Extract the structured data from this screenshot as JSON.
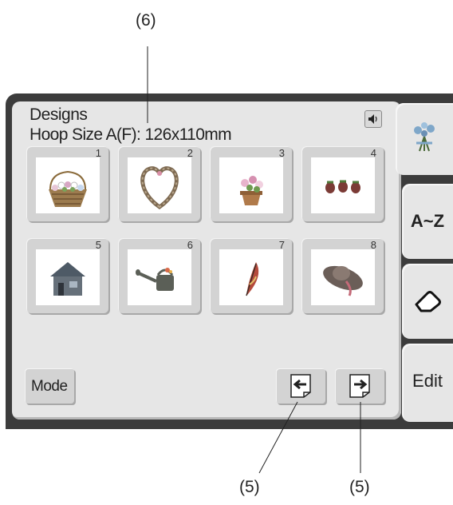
{
  "callouts": {
    "top": "(6)",
    "bottom_left": "(5)",
    "bottom_right": "(5)"
  },
  "screen": {
    "title": "Designs",
    "hoop_size": "Hoop Size A(F): 126x110mm"
  },
  "designs": [
    {
      "number": "1",
      "icon": "flower-basket-icon"
    },
    {
      "number": "2",
      "icon": "heart-wreath-icon"
    },
    {
      "number": "3",
      "icon": "flower-pot-icon"
    },
    {
      "number": "4",
      "icon": "strawberries-icon"
    },
    {
      "number": "5",
      "icon": "house-icon"
    },
    {
      "number": "6",
      "icon": "watering-can-icon"
    },
    {
      "number": "7",
      "icon": "feather-icon"
    },
    {
      "number": "8",
      "icon": "sun-hat-icon"
    }
  ],
  "buttons": {
    "mode": "Mode"
  },
  "tabs": {
    "az": "A~Z",
    "edit": "Edit"
  },
  "colors": {
    "screen": "#e6e6e6",
    "bezel": "#3c3c3c",
    "tile": "#d3d3d3"
  }
}
